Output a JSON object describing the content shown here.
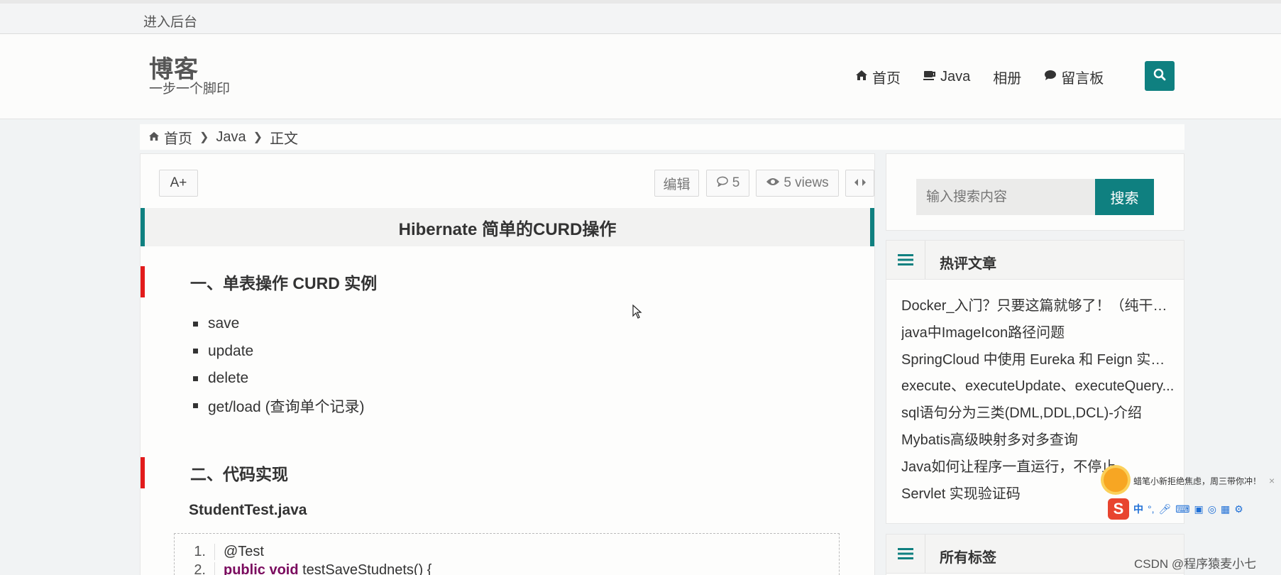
{
  "topbar": {
    "admin_link": "进入后台"
  },
  "header": {
    "logo_title": "博客",
    "logo_subtitle": "一步一个脚印",
    "nav": [
      {
        "label": "首页",
        "icon": "home-icon"
      },
      {
        "label": "Java",
        "icon": "coffee-icon"
      },
      {
        "label": "相册",
        "icon": ""
      },
      {
        "label": "留言板",
        "icon": "comment-icon"
      }
    ],
    "search_icon": "search-icon"
  },
  "breadcrumb": {
    "home": "首页",
    "category": "Java",
    "current": "正文"
  },
  "article": {
    "font_button": "A+",
    "edit": "编辑",
    "comments": "5",
    "views": "5 views",
    "title": "Hibernate 简单的CURD操作",
    "section1": "一、单表操作 CURD 实例",
    "bullets": [
      "save",
      "update",
      "delete",
      "get/load (查询单个记录)"
    ],
    "section2": "二、代码实现",
    "filename": "StudentTest.java",
    "code": [
      {
        "num": "1.",
        "text": "@Test"
      },
      {
        "num": "2.",
        "kw": "public void",
        "text": " testSaveStudnets() {"
      }
    ]
  },
  "sidebar": {
    "search_placeholder": "输入搜索内容",
    "search_button": "搜索",
    "hot_title": "热评文章",
    "hot_items": [
      "Docker_入门？只要这篇就够了！（纯干货适合...",
      "java中ImageIcon路径问题",
      "SpringCloud 中使用 Eureka 和 Feign 实现...",
      "execute、executeUpdate、executeQuery...",
      "sql语句分为三类(DML,DDL,DCL)-介绍",
      "Mybatis高级映射多对多查询",
      "Java如何让程序一直运行，不停止",
      "Servlet 实现验证码"
    ],
    "tags_title": "所有标签"
  },
  "ime": {
    "tip": "蜡笔小新拒绝焦虑，周三带你冲！",
    "chinese_mode": "中"
  },
  "watermark": "CSDN @程序猿麦小七",
  "colors": {
    "accent": "#0f8080",
    "section_marker": "#e21b1b"
  }
}
